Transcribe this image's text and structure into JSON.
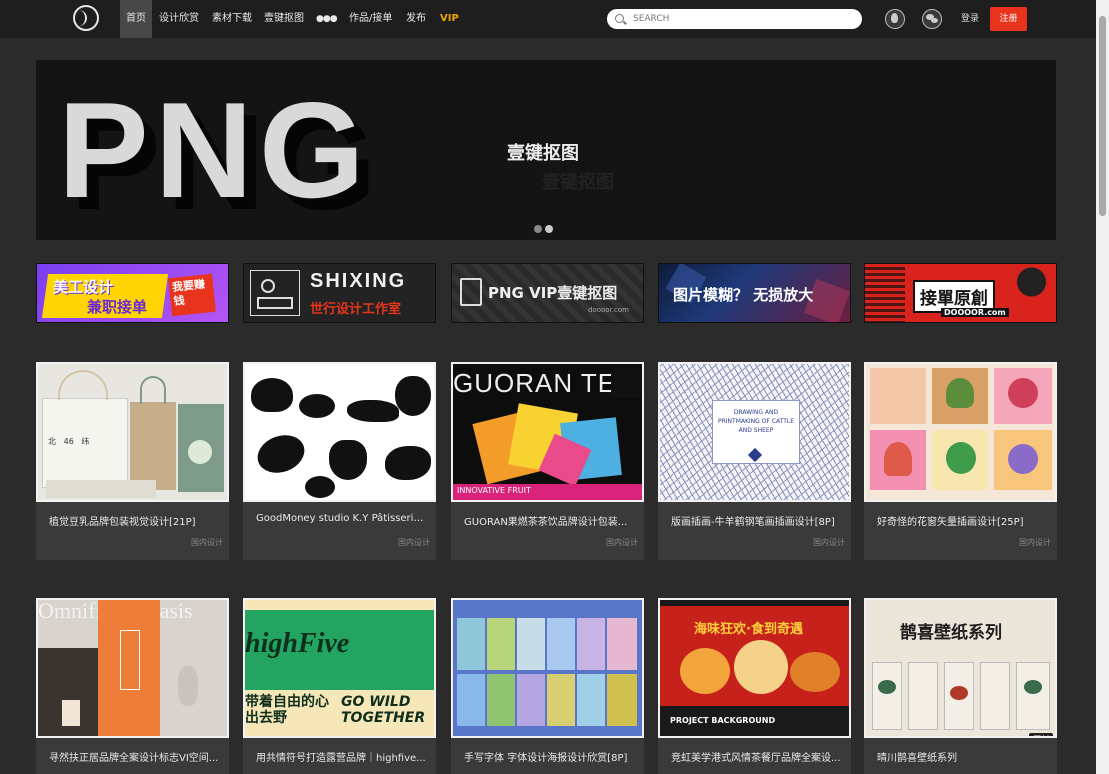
{
  "nav": {
    "items": [
      "首页",
      "设计欣赏",
      "素材下载",
      "壹键抠图",
      "●●●",
      "作品/接单",
      "发布",
      "VIP"
    ],
    "search_placeholder": "SEARCH",
    "login": "登录",
    "register": "注册"
  },
  "hero": {
    "big_text": "PNG",
    "subtitle": "壹键抠图",
    "subtitle_shadow": "壹键抠图"
  },
  "ads": [
    {
      "main": "美工设计",
      "sub": "兼职接单",
      "extra": "我要赚钱"
    },
    {
      "main": "SHIXING",
      "sub": "世行设计工作室"
    },
    {
      "main": "PNG VIP壹键抠图",
      "sub": "doooor.com"
    },
    {
      "main": "图片模糊？ 无损放大"
    },
    {
      "main": "接單原創",
      "sub": "DOOOOR.com"
    }
  ],
  "row1": [
    {
      "title": "植觉豆乳品牌包装视觉设计[21P]",
      "tag": "国内设计"
    },
    {
      "title": "GoodMoney studio K.Y Pâtisserie ...",
      "tag": "国内设计"
    },
    {
      "title": "GUORAN果燃茶茶饮品牌设计包装...",
      "tag": "国内设计"
    },
    {
      "title": "版画插画-牛羊鹤钢笔画插画设计[8P]",
      "tag": "国内设计"
    },
    {
      "title": "好奇怪的花窗矢量插画设计[25P]",
      "tag": "国内设计"
    }
  ],
  "row2": [
    {
      "title": "寻然扶正居品牌全案设计标志VI空间..."
    },
    {
      "title": "用共情符号打造露营品牌｜highfive..."
    },
    {
      "title": "手写字体 字体设计海报设计欣赏[8P]"
    },
    {
      "title": "竞虹美学港式风情茶餐厅品牌全案设..."
    },
    {
      "title": "晴川鹊喜壁纸系列",
      "badge": "原创"
    }
  ],
  "thumbs": {
    "guoran": "GUORAN TEA",
    "guoran_sub": "INNOVATIVE FRUIT",
    "highfive": "highFive",
    "gowild": "GO WILD TOGETHER",
    "outdoor": "带着自由的心 出去野",
    "hk_title": "海味狂欢·食到奇遇",
    "hk_sub": "PROJECT BACKGROUND",
    "wall": "鹊喜壁纸系列",
    "etching": "DRAWING AND PRINTMAKING OF CATTLE AND SHEEP",
    "oasis": "Omnificent Oasis"
  },
  "colors": {
    "register": "#e8341c",
    "vip": "#f0a500",
    "card_bg": "#3a3a3a"
  }
}
